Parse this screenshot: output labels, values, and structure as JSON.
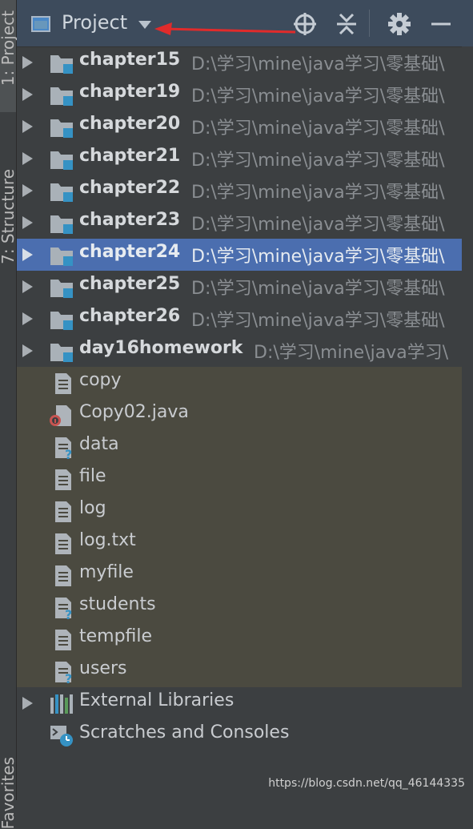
{
  "sidebar": {
    "tabs": [
      {
        "label": "1: Project"
      },
      {
        "label": "7: Structure"
      },
      {
        "label": "Favorites"
      }
    ]
  },
  "header": {
    "view_label": "Project",
    "buttons": [
      "locate-icon",
      "collapse-all-icon",
      "gear-icon",
      "minimize-icon"
    ]
  },
  "tree": {
    "modules": [
      {
        "name": "chapter15",
        "path": "D:\\学习\\mine\\java学习\\零基础\\",
        "selected": false
      },
      {
        "name": "chapter19",
        "path": "D:\\学习\\mine\\java学习\\零基础\\",
        "selected": false
      },
      {
        "name": "chapter20",
        "path": "D:\\学习\\mine\\java学习\\零基础\\",
        "selected": false
      },
      {
        "name": "chapter21",
        "path": "D:\\学习\\mine\\java学习\\零基础\\",
        "selected": false
      },
      {
        "name": "chapter22",
        "path": "D:\\学习\\mine\\java学习\\零基础\\",
        "selected": false
      },
      {
        "name": "chapter23",
        "path": "D:\\学习\\mine\\java学习\\零基础\\",
        "selected": false
      },
      {
        "name": "chapter24",
        "path": "D:\\学习\\mine\\java学习\\零基础\\",
        "selected": true
      },
      {
        "name": "chapter25",
        "path": "D:\\学习\\mine\\java学习\\零基础\\",
        "selected": false
      },
      {
        "name": "chapter26",
        "path": "D:\\学习\\mine\\java学习\\零基础\\",
        "selected": false
      },
      {
        "name": "day16homework",
        "path": "D:\\学习\\mine\\java学习\\",
        "selected": false
      }
    ],
    "files": [
      {
        "name": "copy",
        "icon": "text-file-icon"
      },
      {
        "name": "Copy02.java",
        "icon": "java-file-icon"
      },
      {
        "name": "data",
        "icon": "unknown-file-icon"
      },
      {
        "name": "file",
        "icon": "text-file-icon"
      },
      {
        "name": "log",
        "icon": "text-file-icon"
      },
      {
        "name": "log.txt",
        "icon": "text-file-icon"
      },
      {
        "name": "myfile",
        "icon": "text-file-icon"
      },
      {
        "name": "students",
        "icon": "unknown-file-icon"
      },
      {
        "name": "tempfile",
        "icon": "text-file-icon"
      },
      {
        "name": "users",
        "icon": "unknown-file-icon"
      }
    ],
    "external_libraries": "External Libraries",
    "scratches": "Scratches and Consoles"
  },
  "watermark": "https://blog.csdn.net/qq_46144335",
  "colors": {
    "background": "#3c3f41",
    "header": "#3d4b5c",
    "selection": "#4b6eaf",
    "unversioned_area": "#4b4a40",
    "annotation_arrow": "#e02b2b"
  }
}
